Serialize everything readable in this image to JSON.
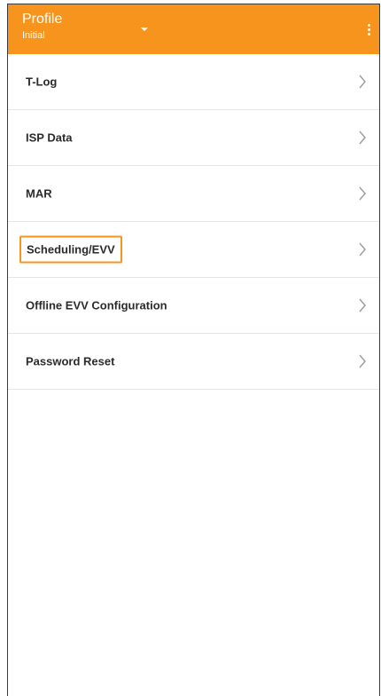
{
  "appbar": {
    "title": "Profile",
    "subtitle": "Initial",
    "dropdown_icon": "caret-down-icon",
    "overflow_icon": "more-vert-icon",
    "color": "#f7941d"
  },
  "menu": {
    "items": [
      {
        "label": "T-Log"
      },
      {
        "label": "ISP Data"
      },
      {
        "label": "MAR"
      },
      {
        "label": "Scheduling/EVV",
        "highlighted": true
      },
      {
        "label": "Offline EVV Configuration"
      },
      {
        "label": "Password Reset"
      }
    ],
    "chevron_icon": "chevron-right-icon"
  },
  "highlight_color": "#f7941d"
}
